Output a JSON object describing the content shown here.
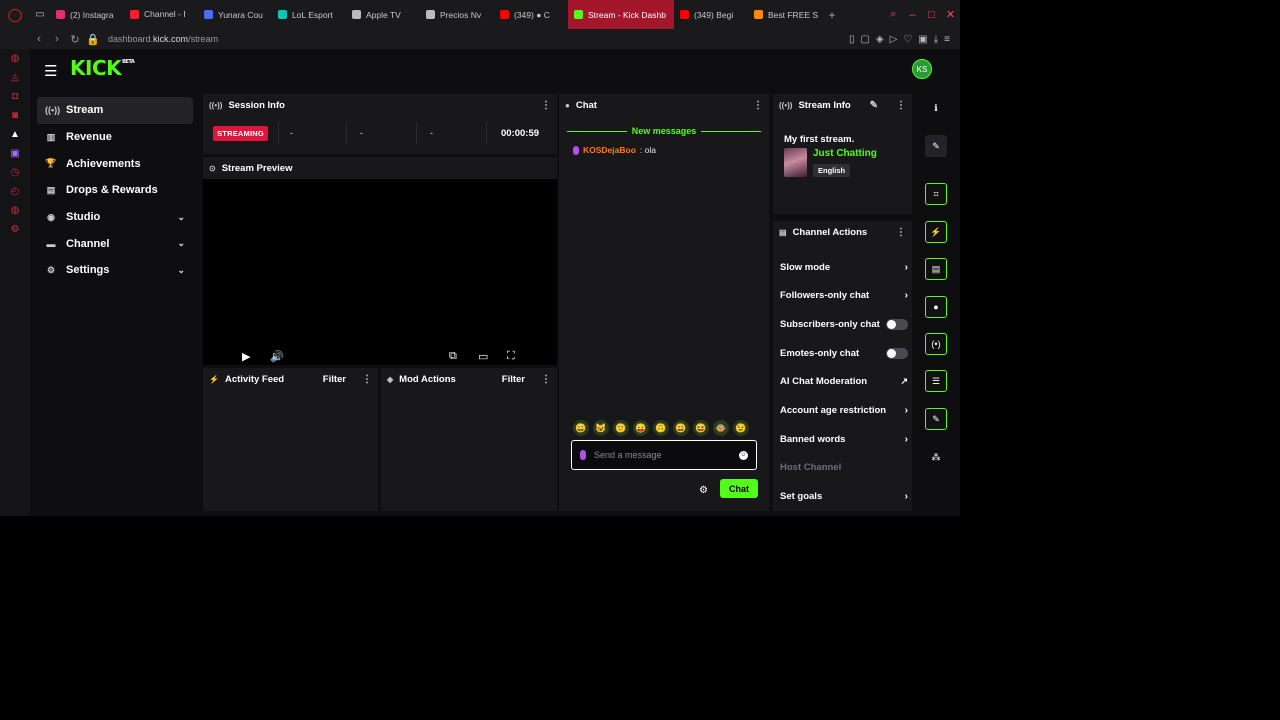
{
  "browser": {
    "tabs": [
      {
        "label": "(2) Instagra",
        "color": "#e1306c",
        "active": false
      },
      {
        "label": "Channel - Ⅰ",
        "color": "#ff1b2d",
        "active": false
      },
      {
        "label": "Yunara Cou",
        "color": "#4a6cf7",
        "active": false
      },
      {
        "label": "LoL Esport",
        "color": "#0ac8b9",
        "active": false
      },
      {
        "label": "Apple TV",
        "color": "#bbbbbb",
        "active": false
      },
      {
        "label": "Precios Nv",
        "color": "#bbbbbb",
        "active": false
      },
      {
        "label": "(349) ● C",
        "color": "#ff0000",
        "active": false
      },
      {
        "label": "Stream - Kick Dashb",
        "color": "#53fc18",
        "active": true
      },
      {
        "label": "(349) Begi",
        "color": "#ff0000",
        "active": false
      },
      {
        "label": "Best FREE S",
        "color": "#ff8a00",
        "active": false
      }
    ],
    "url_prefix": "dashboard.",
    "url_domain": "kick.com",
    "url_path": "/stream"
  },
  "brand": {
    "logo": "KICK",
    "beta": "BETA",
    "accent": "#53fc18",
    "avatar_initials": "KS"
  },
  "nav": {
    "items": [
      {
        "label": "Stream",
        "icon": "broadcast-icon",
        "glyph": "((•))",
        "selected": true,
        "expandable": false
      },
      {
        "label": "Revenue",
        "icon": "revenue-icon",
        "glyph": "▥",
        "selected": false,
        "expandable": false
      },
      {
        "label": "Achievements",
        "icon": "trophy-icon",
        "glyph": "🏆",
        "selected": false,
        "expandable": false
      },
      {
        "label": "Drops & Rewards",
        "icon": "drops-icon",
        "glyph": "▤",
        "selected": false,
        "expandable": false
      },
      {
        "label": "Studio",
        "icon": "studio-icon",
        "glyph": "◉",
        "selected": false,
        "expandable": true
      },
      {
        "label": "Channel",
        "icon": "channel-icon",
        "glyph": "▬",
        "selected": false,
        "expandable": true
      },
      {
        "label": "Settings",
        "icon": "gear-icon",
        "glyph": "⚙",
        "selected": false,
        "expandable": true
      }
    ]
  },
  "session": {
    "title": "Session Info",
    "status": "STREAMING",
    "stat1": "-",
    "stat2": "-",
    "stat3": "-",
    "duration": "00:00:59"
  },
  "preview": {
    "title": "Stream Preview"
  },
  "activity": {
    "title": "Activity Feed",
    "filter": "Filter"
  },
  "mod": {
    "title": "Mod Actions",
    "filter": "Filter"
  },
  "chat": {
    "title": "Chat",
    "new_messages": "New messages",
    "messages": [
      {
        "user": "KOSDejaBoo",
        "text": ": ola"
      }
    ],
    "emotes": [
      "😀",
      "😺",
      "🙂",
      "😛",
      "🙃",
      "😄",
      "😆",
      "🐵",
      "😉"
    ],
    "placeholder": "Send a message",
    "send_label": "Chat"
  },
  "stream_info": {
    "title": "Stream Info",
    "stream_title": "My first stream.",
    "category": "Just Chatting",
    "language": "English"
  },
  "actions": {
    "title": "Channel Actions",
    "rows": [
      {
        "label": "Slow mode",
        "type": "arrow"
      },
      {
        "label": "Followers-only chat",
        "type": "arrow"
      },
      {
        "label": "Subscribers-only chat",
        "type": "toggle",
        "on": false
      },
      {
        "label": "Emotes-only chat",
        "type": "toggle",
        "on": false
      },
      {
        "label": "AI Chat Moderation",
        "type": "external"
      },
      {
        "label": "Account age restriction",
        "type": "arrow"
      },
      {
        "label": "Banned words",
        "type": "arrow"
      },
      {
        "label": "Host Channel",
        "type": "disabled"
      },
      {
        "label": "Set goals",
        "type": "arrow"
      }
    ]
  },
  "rail": [
    {
      "icon": "info-icon",
      "glyph": "ℹ",
      "style": "plain"
    },
    {
      "icon": "edit-icon",
      "glyph": "✎",
      "style": "dark"
    },
    {
      "icon": "screenshot-icon",
      "glyph": "⌗",
      "style": "green"
    },
    {
      "icon": "lightning-icon",
      "glyph": "⚡",
      "style": "green"
    },
    {
      "icon": "document-icon",
      "glyph": "▤",
      "style": "green"
    },
    {
      "icon": "chat-bubble-icon",
      "glyph": "●",
      "style": "green"
    },
    {
      "icon": "broadcast-icon",
      "glyph": "(•)",
      "style": "green"
    },
    {
      "icon": "stack-icon",
      "glyph": "☰",
      "style": "green"
    },
    {
      "icon": "wrench-icon",
      "glyph": "✎",
      "style": "green"
    },
    {
      "icon": "nodes-icon",
      "glyph": "⁂",
      "style": "plain"
    }
  ]
}
